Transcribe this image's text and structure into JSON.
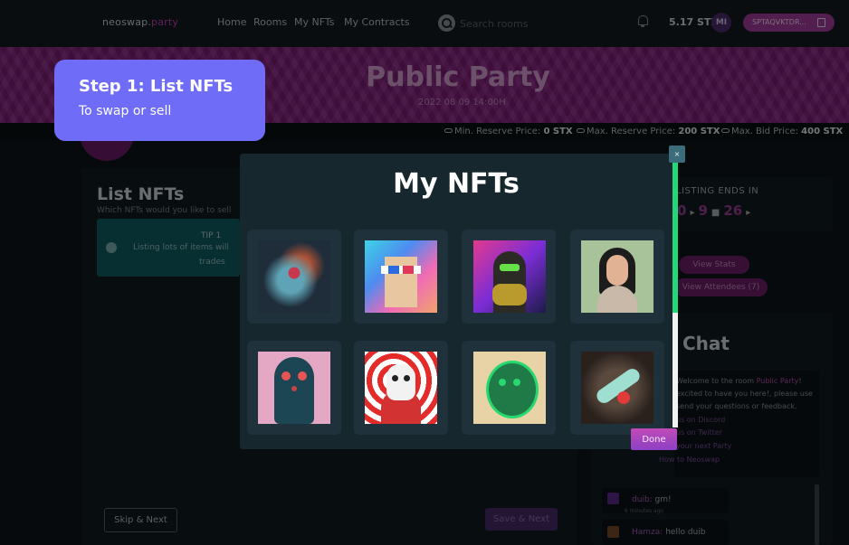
{
  "nav": {
    "logo_main": "neoswap.",
    "logo_accent": "party",
    "links": [
      "Home",
      "Rooms",
      "My NFTs",
      "My Contracts"
    ],
    "search_placeholder": "Search rooms",
    "balance": "5.17 STX",
    "avatar_initials": "MI",
    "wallet": "SPTAQVKTDR..."
  },
  "banner": {
    "title": "Public Party",
    "date": "2022 08 09 14:00H"
  },
  "prices": {
    "min_label": "Min. Reserve Price:",
    "min_value": "0 STX",
    "max_label": "Max. Reserve Price:",
    "max_value": "200 STX",
    "bid_label": "Max. Bid Price:",
    "bid_value": "400 STX"
  },
  "list_panel": {
    "title": "List NFTs",
    "subtitle": "Which NFTs would you like to sell",
    "tip_title": "TIP 1",
    "tip_text": "Listing lots of items will",
    "tip_text2": "trades",
    "skip_label": "Skip & Next",
    "save_label": "Save & Next"
  },
  "countdown": {
    "label": "LISTING ENDS IN",
    "v1": "0",
    "v2": "9",
    "v3": "26"
  },
  "actions": {
    "stats": "View Stats",
    "attendees": "View Attendees (7)"
  },
  "chat": {
    "title": "Chat",
    "welcome_1a": "Welcome to the room ",
    "welcome_1b": "Public Party",
    "welcome_2": "excited to have you here!, please use",
    "welcome_3": "send your questions or feedback.",
    "link_1": "us on Discord",
    "link_2": "us on Twitter",
    "link_3": "your next Party",
    "link_4": "How to Neoswap",
    "messages": [
      {
        "user": "duib:",
        "text": "gm!",
        "time": "6 minutes ago"
      },
      {
        "user": "Hamza:",
        "text": "hello duib",
        "time": ""
      }
    ]
  },
  "modal": {
    "title": "My NFTs",
    "close": "×",
    "done": "Done"
  },
  "tooltip": {
    "title": "Step 1: List NFTs",
    "subtitle": "To swap or sell"
  }
}
